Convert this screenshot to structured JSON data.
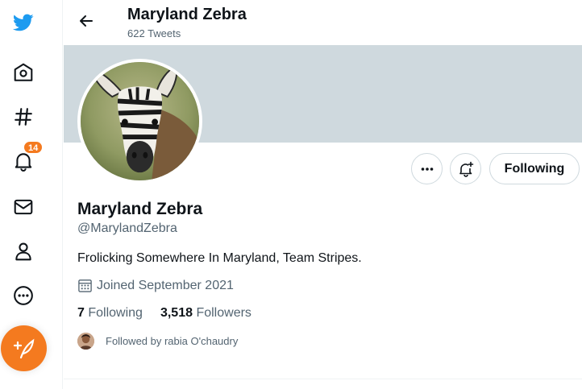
{
  "colors": {
    "accent": "#f47a1f",
    "twitter_blue": "#1d9bf0",
    "banner": "#cfd9de",
    "text_primary": "#0f1419",
    "text_secondary": "#536471"
  },
  "sidebar": {
    "items": [
      {
        "icon": "twitter-logo-icon"
      },
      {
        "icon": "home-icon"
      },
      {
        "icon": "hashtag-icon"
      },
      {
        "icon": "bell-icon",
        "badge": "14"
      },
      {
        "icon": "envelope-icon"
      },
      {
        "icon": "person-icon"
      },
      {
        "icon": "more-icon"
      }
    ],
    "compose_icon": "compose-tweet-icon"
  },
  "header": {
    "title": "Maryland Zebra",
    "subtitle": "622 Tweets"
  },
  "profile": {
    "name": "Maryland Zebra",
    "handle": "@MarylandZebra",
    "bio": "Frolicking Somewhere In Maryland, Team Stripes.",
    "joined": "Joined September 2021",
    "following_count": "7",
    "following_label": "Following",
    "followers_count": "3,518",
    "followers_label": "Followers",
    "followed_by": "Followed by rabia O'chaudry"
  },
  "actions": {
    "following_button": "Following"
  }
}
